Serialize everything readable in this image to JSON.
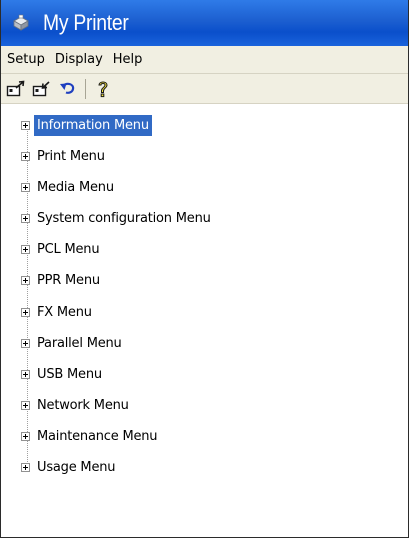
{
  "window": {
    "title": "My Printer",
    "icon": "printer-icon"
  },
  "menubar": {
    "items": [
      "Setup",
      "Display",
      "Help"
    ]
  },
  "toolbar": {
    "buttons": [
      "expand-all-icon",
      "collapse-all-icon",
      "undo-icon",
      "help-icon"
    ]
  },
  "tree": {
    "items": [
      {
        "label": "Information Menu",
        "selected": true
      },
      {
        "label": "Print Menu",
        "selected": false
      },
      {
        "label": "Media Menu",
        "selected": false
      },
      {
        "label": "System configuration Menu",
        "selected": false
      },
      {
        "label": "PCL Menu",
        "selected": false
      },
      {
        "label": "PPR Menu",
        "selected": false
      },
      {
        "label": "FX Menu",
        "selected": false
      },
      {
        "label": "Parallel Menu",
        "selected": false
      },
      {
        "label": "USB Menu",
        "selected": false
      },
      {
        "label": "Network Menu",
        "selected": false
      },
      {
        "label": "Maintenance Menu",
        "selected": false
      },
      {
        "label": "Usage Menu",
        "selected": false
      }
    ]
  },
  "colors": {
    "titlebar": "#0a4fcb",
    "selection": "#316ac5",
    "chrome": "#f1efe2"
  }
}
